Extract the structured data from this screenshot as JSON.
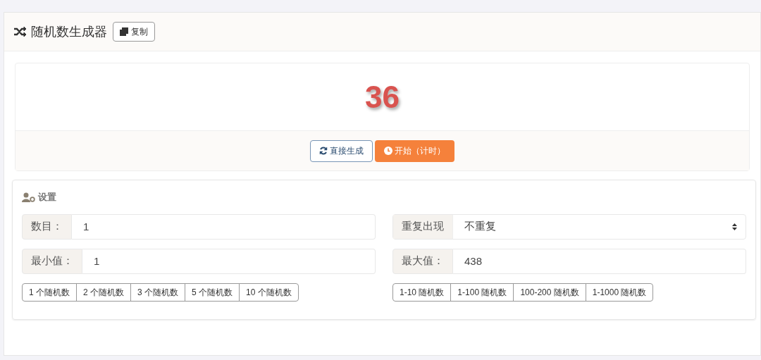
{
  "header": {
    "title": "随机数生成器",
    "copy_button": "复制"
  },
  "result": {
    "value": "36"
  },
  "actions": [
    {
      "kind": "generate",
      "label": "直接生成"
    },
    {
      "kind": "timer",
      "label": "开始（计时）"
    }
  ],
  "settings": {
    "title": "设置",
    "left": {
      "fields": [
        {
          "kind": "input",
          "label": "数目：",
          "value": "1"
        },
        {
          "kind": "input",
          "label": "最小值：",
          "value": "1"
        }
      ],
      "presets": [
        "1 个随机数",
        "2 个随机数",
        "3 个随机数",
        "5 个随机数",
        "10 个随机数"
      ]
    },
    "right": {
      "fields": [
        {
          "kind": "select",
          "label": "重复出现",
          "value": "不重复"
        },
        {
          "kind": "input",
          "label": "最大值：",
          "value": "438"
        }
      ],
      "presets": [
        "1-10 随机数",
        "1-100 随机数",
        "100-200 随机数",
        "1-1000 随机数"
      ]
    }
  }
}
